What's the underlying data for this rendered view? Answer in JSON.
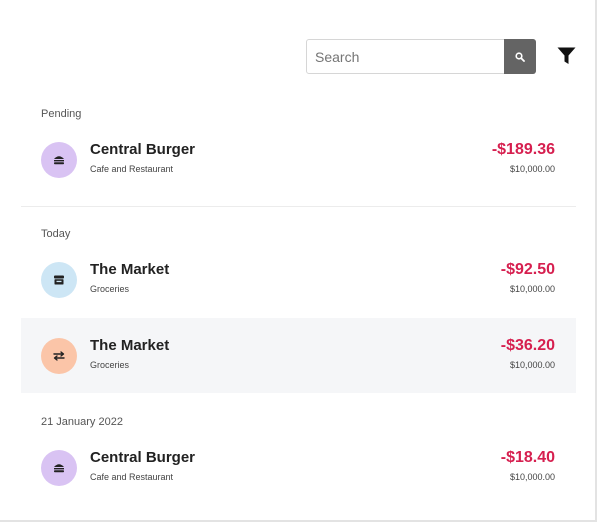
{
  "search": {
    "placeholder": "Search",
    "value": ""
  },
  "icons": {
    "search": "search-icon",
    "filter": "filter-icon"
  },
  "colors": {
    "debit": "#d61f4f",
    "restaurant": "#d9c3f3",
    "groceries": "#cde6f5",
    "transfer": "#fbc5a8"
  },
  "sections": [
    {
      "label": "Pending",
      "transactions": [
        {
          "merchant": "Central Burger",
          "category": "Cafe and Restaurant",
          "amount": "-$189.36",
          "balance": "$10,000.00",
          "icon": "burger-icon"
        }
      ]
    },
    {
      "label": "Today",
      "transactions": [
        {
          "merchant": "The Market",
          "category": "Groceries",
          "amount": "-$92.50",
          "balance": "$10,000.00",
          "icon": "store-icon"
        },
        {
          "merchant": "The Market",
          "category": "Groceries",
          "amount": "-$36.20",
          "balance": "$10,000.00",
          "icon": "transfer-icon"
        }
      ]
    },
    {
      "label": "21 January 2022",
      "transactions": [
        {
          "merchant": "Central Burger",
          "category": "Cafe and Restaurant",
          "amount": "-$18.40",
          "balance": "$10,000.00",
          "icon": "burger-icon"
        }
      ]
    }
  ]
}
